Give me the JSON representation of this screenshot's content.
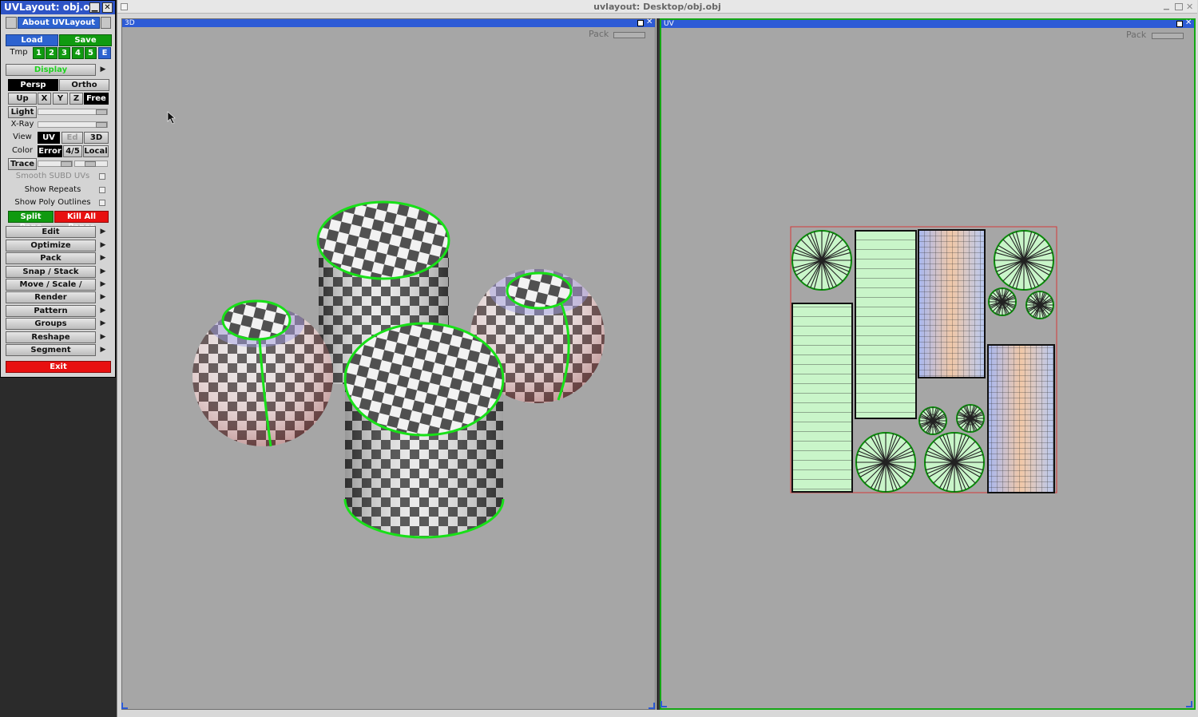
{
  "panel": {
    "title": "UVLayout: obj.obj",
    "about": "About UVLayout",
    "load": "Load",
    "save": "Save",
    "tmp": "Tmp",
    "slots": [
      "1",
      "2",
      "3",
      "4",
      "5",
      "E"
    ],
    "display": "Display",
    "persp": "Persp",
    "ortho": "Ortho",
    "up": "Up",
    "axes": [
      "X",
      "Y",
      "Z",
      "Free"
    ],
    "light": "Light",
    "xray": "X-Ray",
    "view": "View",
    "view_opts": [
      "UV",
      "Ed",
      "3D"
    ],
    "color": "Color",
    "color_opts": [
      "Error",
      "4/5",
      "Local"
    ],
    "trace": "Trace",
    "smooth": "Smooth SUBD UVs",
    "show_repeats": "Show Repeats",
    "show_poly": "Show Poly Outlines",
    "split": "Split Pane",
    "kill": "Kill All Panes",
    "menus": [
      "Edit",
      "Optimize",
      "Pack",
      "Snap / Stack",
      "Move / Scale / Rotate",
      "Render",
      "Pattern",
      "Groups",
      "Reshape",
      "Segment"
    ],
    "exit": "Exit"
  },
  "main": {
    "title": "uvlayout: Desktop/obj.obj",
    "pane3d": {
      "label": "3D",
      "pack": "Pack"
    },
    "paneuv": {
      "label": "UV",
      "pack": "Pack"
    }
  },
  "colors": {
    "accent_blue": "#2d5bd6",
    "green": "#109a10",
    "red": "#e81010",
    "outline_green": "#1fd21f",
    "viewport_bg": "#a6a6a6"
  }
}
